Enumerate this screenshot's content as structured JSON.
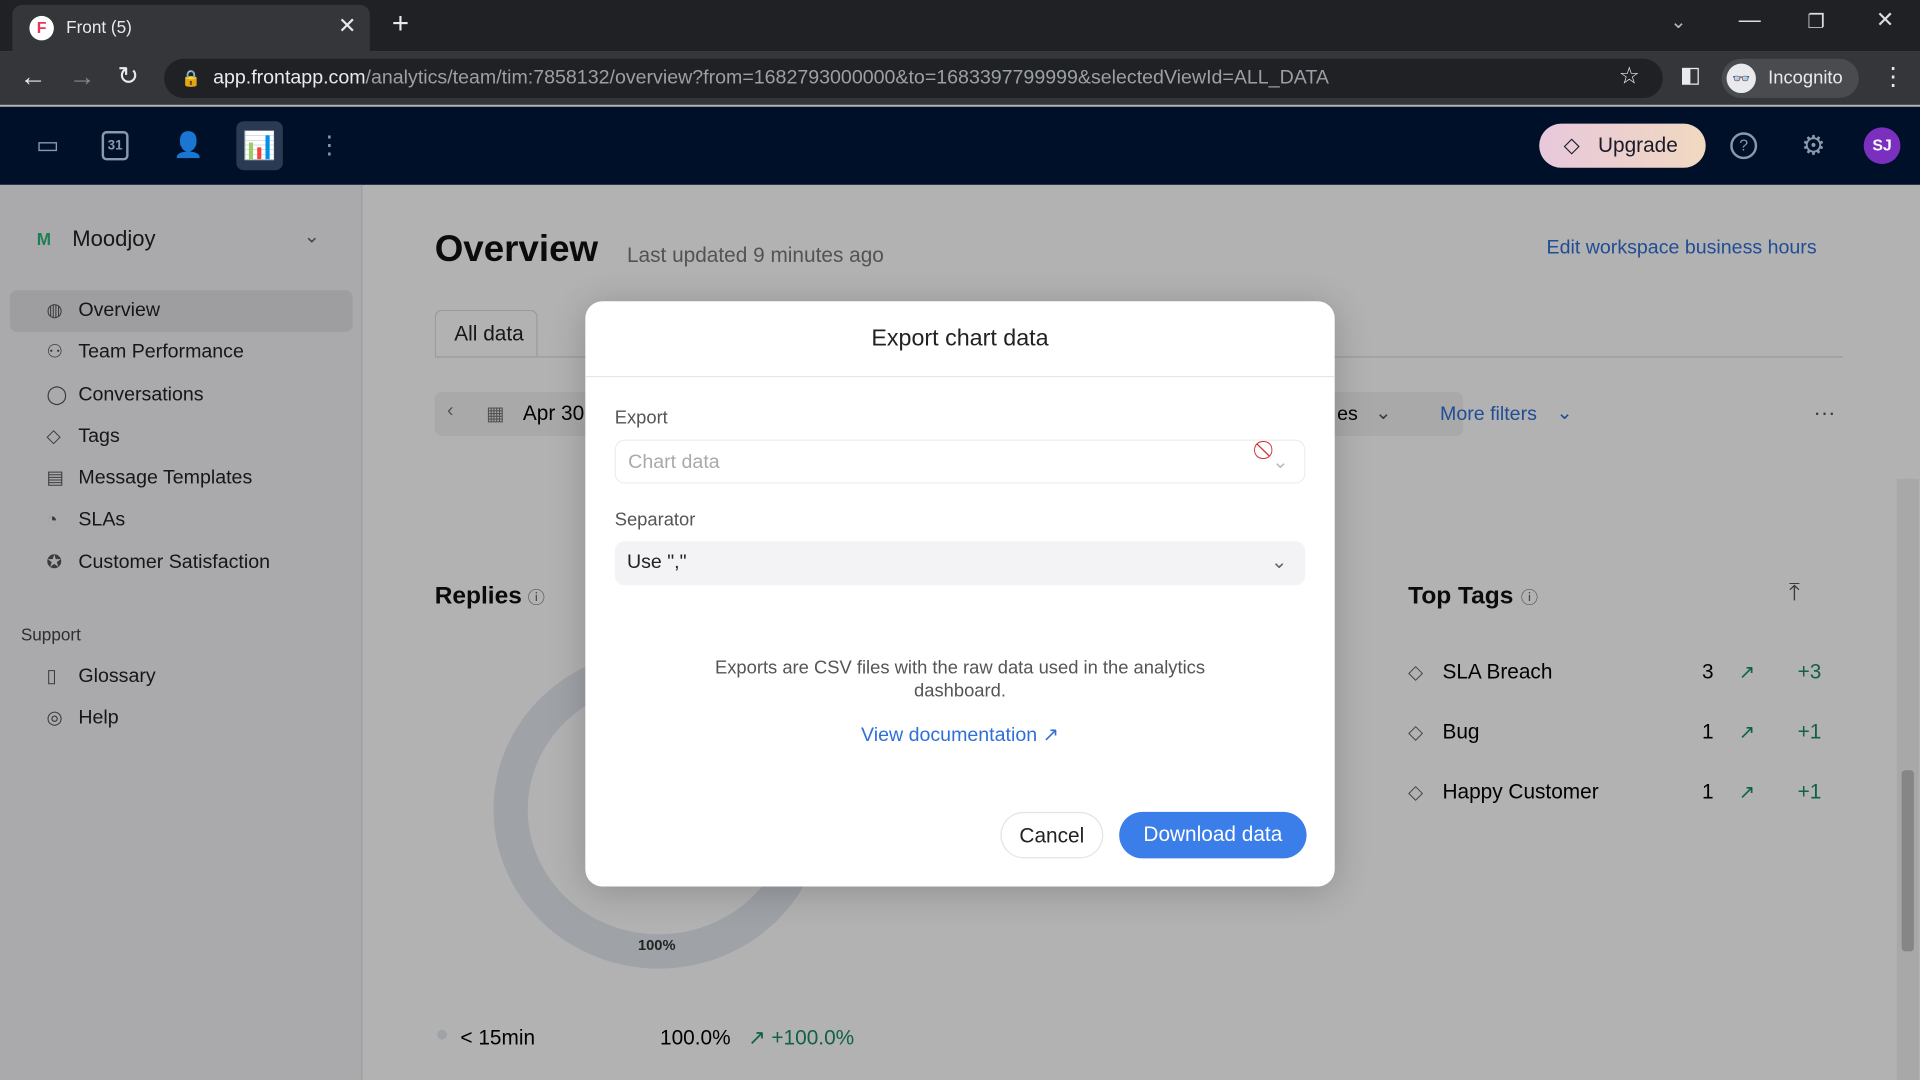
{
  "browser": {
    "tab_title": "Front (5)",
    "url_host": "app.frontapp.com",
    "url_path": "/analytics/team/tim:7858132/overview?from=1682793000000&to=1683397799999&selectedViewId=ALL_DATA",
    "profile": "Incognito"
  },
  "topnav": {
    "upgrade": "Upgrade",
    "avatar": "SJ",
    "calendar_day": "31"
  },
  "sidebar": {
    "workspace_initial": "M",
    "workspace": "Moodjoy",
    "items": [
      {
        "label": "Overview"
      },
      {
        "label": "Team Performance"
      },
      {
        "label": "Conversations"
      },
      {
        "label": "Tags"
      },
      {
        "label": "Message Templates"
      },
      {
        "label": "SLAs"
      },
      {
        "label": "Customer Satisfaction"
      }
    ],
    "support_heading": "Support",
    "support_items": [
      {
        "label": "Glossary"
      },
      {
        "label": "Help"
      }
    ]
  },
  "main": {
    "title": "Overview",
    "last_updated": "Last updated 9 minutes ago",
    "edit_hours": "Edit workspace business hours",
    "tab_all": "All data",
    "date": "Apr 30",
    "filter_partial": "es",
    "more_filters": "More filters",
    "replies": "Replies",
    "donut_label": "100%",
    "legend_label": "< 15min",
    "legend_pct": "100.0%",
    "legend_delta": "+100.0%",
    "top_tags": "Top Tags",
    "tags": [
      {
        "name": "SLA Breach",
        "count": "3",
        "delta": "+3"
      },
      {
        "name": "Bug",
        "count": "1",
        "delta": "+1"
      },
      {
        "name": "Happy Customer",
        "count": "1",
        "delta": "+1"
      }
    ]
  },
  "modal": {
    "title": "Export chart data",
    "export_label": "Export",
    "export_value": "Chart data",
    "separator_label": "Separator",
    "separator_value": "Use \",\"",
    "info": "Exports are CSV files with the raw data used in the analytics dashboard.",
    "doc_link": "View documentation",
    "cancel": "Cancel",
    "download": "Download data"
  },
  "colors": {
    "accent": "#3b7de9",
    "nav_bg": "#001028",
    "link": "#2f6fd6"
  }
}
